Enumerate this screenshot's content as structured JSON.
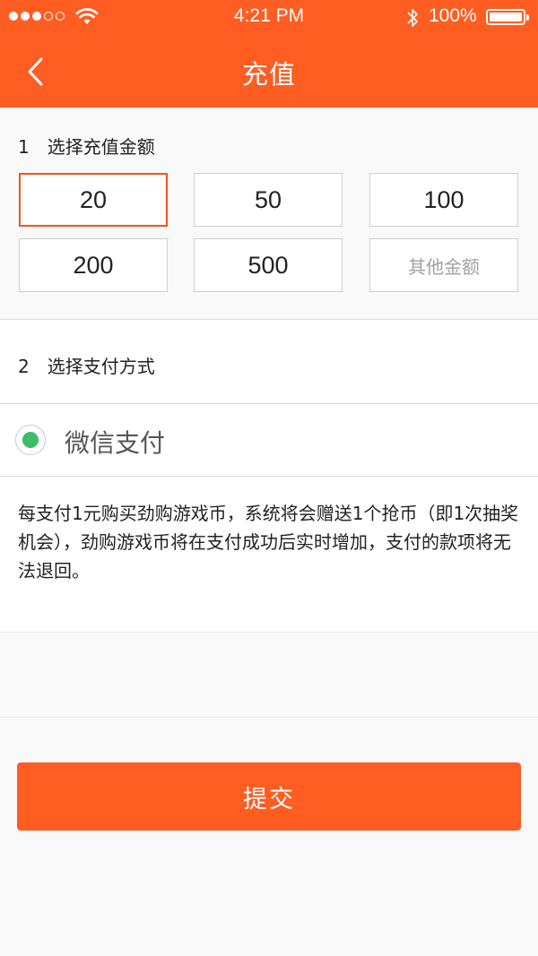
{
  "status_bar": {
    "time": "4:21 PM",
    "battery": "100%"
  },
  "header": {
    "title": "充值",
    "back_icon": "chevron-left-icon"
  },
  "amount_section": {
    "number": "1",
    "label": "选择充值金额",
    "options": [
      "20",
      "50",
      "100",
      "200",
      "500",
      "其他金额"
    ],
    "selected": "20"
  },
  "payment_section": {
    "number": "2",
    "label": "选择支付方式",
    "method": "微信支付",
    "selected_color": "#3dbd68"
  },
  "notice": "每支付1元购买劲购游戏币，系统将会赠送1个抢币（即1次抽奖机会），劲购游戏币将在支付成功后实时增加，支付的款项将无法退回。",
  "submit_label": "提交",
  "colors": {
    "accent": "#ff5d22",
    "selected_border": "#f0551c"
  }
}
